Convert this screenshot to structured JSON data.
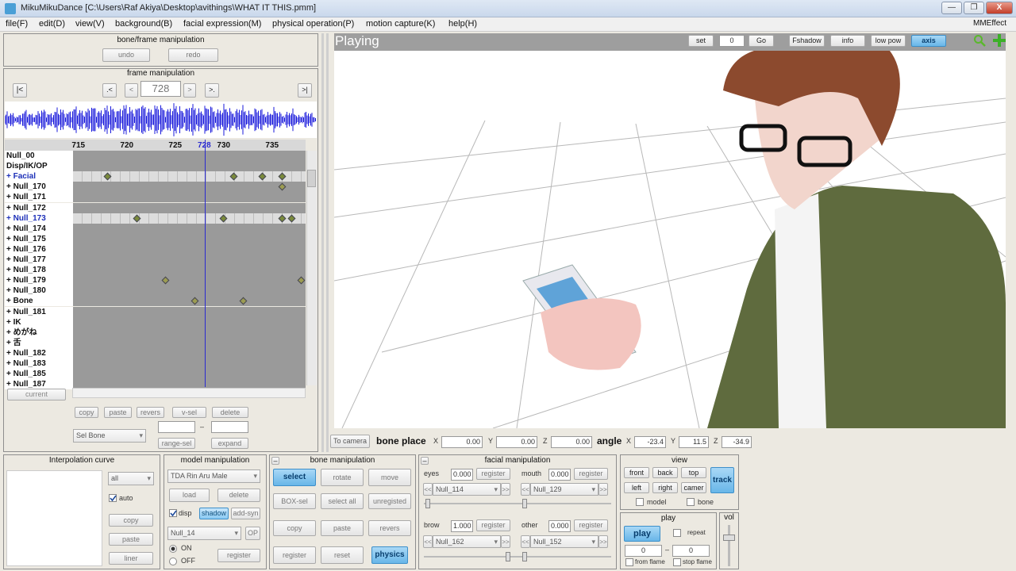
{
  "window": {
    "title": "MikuMikuDance [C:\\Users\\Raf Akiya\\Desktop\\avithings\\WHAT IT THIS.pmm]",
    "minimize": "—",
    "maximize": "❐",
    "close": "X"
  },
  "menu": [
    "file(F)",
    "edit(D)",
    "view(V)",
    "background(B)",
    "facial expression(M)",
    "physical operation(P)",
    "motion capture(K)",
    "help(H)"
  ],
  "mmeffect": "MMEffect",
  "bone_frame": {
    "title": "bone/frame manipulation",
    "undo": "undo",
    "redo": "redo"
  },
  "frame": {
    "title": "frame manipulation",
    "first": "|<",
    "prev_key": ".<",
    "prev": "<",
    "value": "728",
    "next": ">",
    "next_key": ">.",
    "last": ">|",
    "current": "current"
  },
  "timeline": {
    "ticks": [
      "715",
      "720",
      "725",
      "728",
      "730",
      "735"
    ],
    "current_frame": 728,
    "rows": [
      {
        "label": "Null_00",
        "light": false,
        "keys": []
      },
      {
        "label": "Disp/IK/OP",
        "light": false,
        "keys": []
      },
      {
        "label": "+ Facial",
        "light": true,
        "blue": true,
        "keys": [
          718,
          731,
          734,
          736
        ]
      },
      {
        "label": "+ Null_170",
        "light": false,
        "keys": [
          736
        ]
      },
      {
        "label": "+ Null_171",
        "light": false,
        "keys": []
      },
      {
        "label": "+ Null_172",
        "light": false,
        "keys": []
      },
      {
        "label": "+ Null_173",
        "light": true,
        "blue": true,
        "keys": [
          721,
          730,
          736,
          737
        ]
      },
      {
        "label": "+ Null_174",
        "light": false,
        "keys": []
      },
      {
        "label": "+ Null_175",
        "light": false,
        "keys": []
      },
      {
        "label": "+ Null_176",
        "light": false,
        "keys": []
      },
      {
        "label": "+ Null_177",
        "light": false,
        "keys": []
      },
      {
        "label": "+ Null_178",
        "light": false,
        "keys": []
      },
      {
        "label": "+ Null_179",
        "light": false,
        "keys": [
          724,
          738
        ]
      },
      {
        "label": "+ Null_180",
        "light": false,
        "keys": []
      },
      {
        "label": "+ Bone",
        "light": false,
        "keys": [
          727,
          732
        ]
      },
      {
        "label": "+ Null_181",
        "light": false,
        "keys": []
      },
      {
        "label": "+ IK",
        "light": false,
        "keys": []
      },
      {
        "label": "+ めがね",
        "light": false,
        "keys": []
      },
      {
        "label": "+ 舌",
        "light": false,
        "keys": []
      },
      {
        "label": "+ Null_182",
        "light": false,
        "keys": []
      },
      {
        "label": "+ Null_183",
        "light": false,
        "keys": []
      },
      {
        "label": "+ Null_185",
        "light": false,
        "keys": []
      },
      {
        "label": "+ Null_187",
        "light": false,
        "keys": []
      }
    ]
  },
  "frame_ops": {
    "copy": "copy",
    "paste": "paste",
    "revers": "revers",
    "vsel": "v-sel",
    "delete": "delete",
    "selbone": "Sel Bone",
    "range_sel": "range-sel",
    "expand": "expand",
    "dash": "–"
  },
  "viewport": {
    "title": "Playing",
    "set": "set",
    "frame": "0",
    "go": "Go",
    "fshadow": "Fshadow",
    "info": "info",
    "lowpow": "low pow",
    "axis": "axis"
  },
  "bonebar": {
    "to_camera": "To camera",
    "bone_place": "bone place",
    "x": "0.00",
    "y": "0.00",
    "z": "0.00",
    "angle": "angle",
    "ax": "-23.4",
    "ay": "11.5",
    "az": "-34.9",
    "lx": "X",
    "ly": "Y",
    "lz": "Z"
  },
  "interp": {
    "title": "Interpolation curve",
    "select": "all",
    "auto": "auto",
    "copy": "copy",
    "paste": "paste",
    "liner": "liner"
  },
  "model": {
    "title": "model manipulation",
    "model": "TDA Rin Aru Male",
    "load": "load",
    "delete": "delete",
    "disp": "disp",
    "shadow": "shadow",
    "addsyn": "add-syn",
    "bone": "Null_14",
    "op": "OP",
    "on": "ON",
    "off": "OFF",
    "register": "register"
  },
  "bone": {
    "title": "bone manipulation",
    "select": "select",
    "rotate": "rotate",
    "move": "move",
    "boxsel": "BOX-sel",
    "selectall": "select all",
    "unregisted": "unregisted",
    "copy": "copy",
    "paste": "paste",
    "revers": "revers",
    "register": "register",
    "reset": "reset",
    "physics": "physics",
    "collapse": "–"
  },
  "facial": {
    "title": "facial manipulation",
    "eyes": "eyes",
    "eyes_val": "0.000",
    "eyes_sel": "Null_114",
    "mouth": "mouth",
    "mouth_val": "0.000",
    "mouth_sel": "Null_129",
    "brow": "brow",
    "brow_val": "1.000",
    "brow_sel": "Null_162",
    "other": "other",
    "other_val": "0.000",
    "other_sel": "Null_152",
    "register": "register",
    "lt": "<<",
    "gt": ">>",
    "collapse": "–"
  },
  "view": {
    "title": "view",
    "front": "front",
    "back": "back",
    "top": "top",
    "left": "left",
    "right": "right",
    "camera": "camer",
    "track": "track",
    "model": "model",
    "bone": "bone"
  },
  "play": {
    "title": "play",
    "play": "play",
    "repeat": "repeat",
    "from": "0",
    "to": "0",
    "dash": "–",
    "from_flame": "from flame",
    "stop_flame": "stop flame"
  },
  "vol": {
    "title": "vol",
    "level": 0.75
  }
}
